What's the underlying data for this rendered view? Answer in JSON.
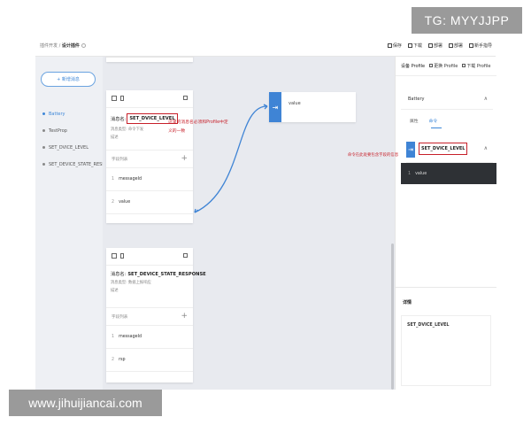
{
  "header": {
    "breadcrumb_parent": "插件开发",
    "breadcrumb_sep": " / ",
    "breadcrumb_current": "设计插件",
    "toolbar": [
      {
        "label": "保存",
        "icon": "save-icon"
      },
      {
        "label": "下载",
        "icon": "download-icon"
      },
      {
        "label": "部署",
        "icon": "deploy-icon"
      },
      {
        "label": "部署",
        "icon": "deploy-icon"
      },
      {
        "label": "新手指导",
        "icon": "guide-icon"
      }
    ]
  },
  "left": {
    "add_button": "+ 新增消息",
    "messages": [
      "Battery",
      "TestProp",
      "SET_DVICE_LEVEL",
      "SET_DEVICE_STATE_RESP..."
    ]
  },
  "canvas": {
    "card_a": {
      "name_prefix": "消息名:",
      "name_value": "SET_DVICE_LEVEL",
      "type_line": "消息类型: 命令下发",
      "extra_line": "描述",
      "fields_header": "字段列表",
      "plus": "+",
      "fields": [
        {
          "index": "1",
          "name": "messageId"
        },
        {
          "index": "2",
          "name": "value"
        }
      ]
    },
    "card_b": {
      "name_prefix": "消息名:",
      "name_value": "SET_DEVICE_STATE_RESPONSE",
      "type_line": "消息类型: 数据上报响应",
      "extra_line": "描述",
      "fields_header": "字段列表",
      "plus": "+",
      "fields": [
        {
          "index": "1",
          "name": "messageId"
        },
        {
          "index": "2",
          "name": "rsp"
        }
      ]
    },
    "value_node": {
      "label": "value",
      "icon": "arrow-in-icon"
    },
    "annotation": "这里的消息名必须和Profile中定义的一致"
  },
  "right": {
    "header_title": "设备 Profile",
    "header_links": [
      "更换 Profile",
      "下载 Profile"
    ],
    "section": "Battery",
    "tabs": [
      "属性",
      "命令"
    ],
    "active_tab": "命令",
    "command_name": "SET_DVICE_LEVEL",
    "command_field": {
      "index": "1",
      "name": "value"
    },
    "annotation": "命令在此处要包含字段的信息",
    "detail_title": "详情",
    "detail_value": "SET_DVICE_LEVEL"
  },
  "watermarks": {
    "top_right": "TG: MYYJJPP",
    "bottom_left": "www.jihuijiancai.com"
  },
  "colors": {
    "accent": "#3f84d5",
    "annotation_red": "#c7202a",
    "canvas_bg": "#e8eaef"
  }
}
